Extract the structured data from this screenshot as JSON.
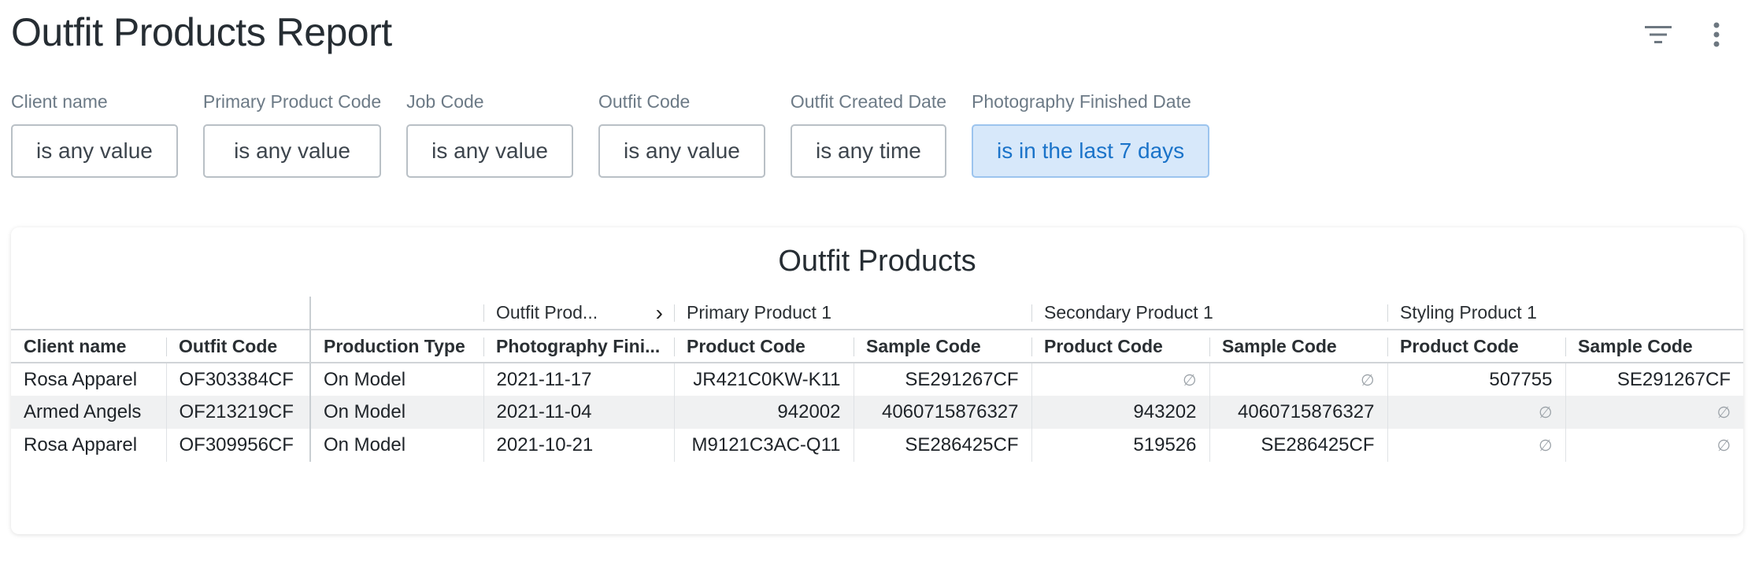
{
  "report": {
    "title": "Outfit Products Report"
  },
  "toolbar": {
    "filter_icon": "filter-list-icon",
    "menu_icon": "more-vert-icon"
  },
  "filters": [
    {
      "label": "Client name",
      "value": "is any value",
      "active": false
    },
    {
      "label": "Primary Product Code",
      "value": "is any value",
      "active": false
    },
    {
      "label": "Job Code",
      "value": "is any value",
      "active": false
    },
    {
      "label": "Outfit Code",
      "value": "is any value",
      "active": false
    },
    {
      "label": "Outfit Created Date",
      "value": "is any time",
      "active": false
    },
    {
      "label": "Photography Finished Date",
      "value": "is in the last 7 days",
      "active": true
    }
  ],
  "card": {
    "title": "Outfit Products",
    "groups": {
      "outfit_prod": "Outfit Prod...",
      "primary": "Primary Product 1",
      "secondary": "Secondary Product 1",
      "styling": "Styling Product 1"
    },
    "columns": [
      "Client name",
      "Outfit Code",
      "Production Type",
      "Photography Fini...",
      "Product Code",
      "Sample Code",
      "Product Code",
      "Sample Code",
      "Product Code",
      "Sample Code"
    ],
    "rows": [
      [
        "Rosa Apparel",
        "OF303384CF",
        "On Model",
        "2021-11-17",
        "JR421C0KW-K11",
        "SE291267CF",
        "∅",
        "∅",
        "507755",
        "SE291267CF"
      ],
      [
        "Armed Angels",
        "OF213219CF",
        "On Model",
        "2021-11-04",
        "942002",
        "4060715876327",
        "943202",
        "4060715876327",
        "∅",
        "∅"
      ],
      [
        "Rosa Apparel",
        "OF309956CF",
        "On Model",
        "2021-10-21",
        "M9121C3AC-Q11",
        "SE286425CF",
        "519526",
        "SE286425CF",
        "∅",
        "∅"
      ]
    ]
  },
  "colors": {
    "accent": "#1a73c9",
    "active_chip_bg": "#d7e8fa",
    "alt_row_bg": "#f0f1f2"
  }
}
